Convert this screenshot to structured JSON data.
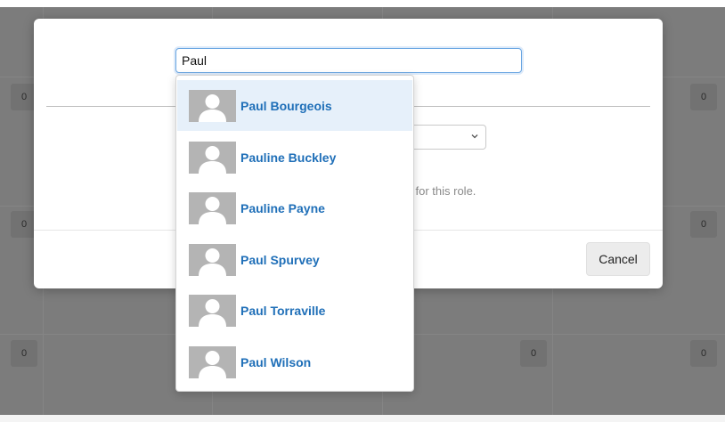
{
  "search": {
    "value": "Paul",
    "placeholder": ""
  },
  "results": [
    {
      "name": "Paul Bourgeois"
    },
    {
      "name": "Pauline Buckley"
    },
    {
      "name": "Pauline Payne"
    },
    {
      "name": "Paul Spurvey"
    },
    {
      "name": "Paul Torraville"
    },
    {
      "name": "Paul Wilson"
    }
  ],
  "modal": {
    "role_text_fragment": "l for this role.",
    "cancel_label": "Cancel"
  },
  "background_grid": {
    "badges": [
      "0",
      "0",
      "0",
      "0",
      "0",
      "0",
      "0"
    ]
  },
  "colors": {
    "link": "#1f6fb8",
    "active_row": "#e6f0fa",
    "input_focus": "#6aa6e2"
  }
}
